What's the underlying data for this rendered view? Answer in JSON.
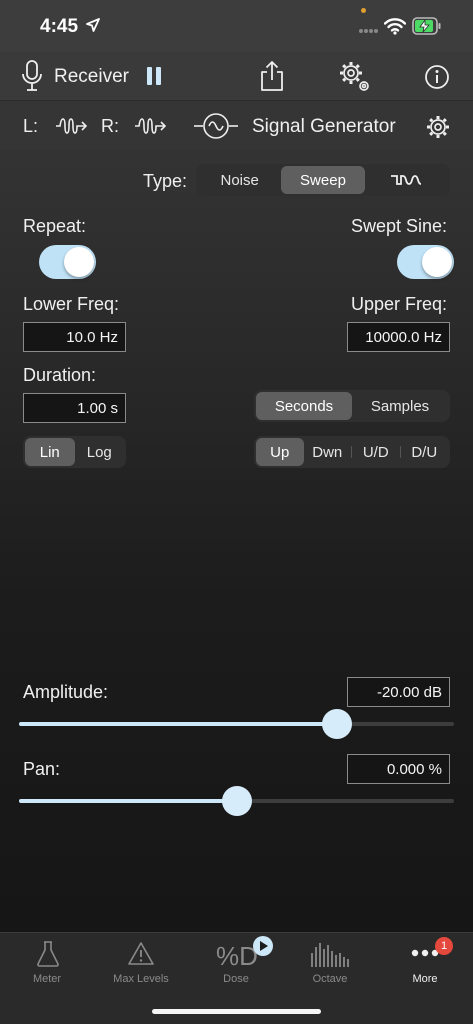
{
  "status_bar": {
    "time": "4:45"
  },
  "header": {
    "receiver_label": "Receiver",
    "left_channel_label": "L:",
    "right_channel_label": "R:",
    "generator_label": "Signal Generator"
  },
  "type_selector": {
    "label": "Type:",
    "options": [
      "Noise",
      "Sweep",
      "⊓∿"
    ],
    "selected": "Sweep"
  },
  "repeat": {
    "label": "Repeat:",
    "on": true
  },
  "swept_sine": {
    "label": "Swept Sine:",
    "on": true
  },
  "lower_freq": {
    "label": "Lower Freq:",
    "value": "10.0 Hz"
  },
  "upper_freq": {
    "label": "Upper Freq:",
    "value": "10000.0 Hz"
  },
  "duration": {
    "label": "Duration:",
    "value": "1.00 s"
  },
  "duration_unit": {
    "options": [
      "Seconds",
      "Samples"
    ],
    "selected": "Seconds"
  },
  "scale": {
    "options": [
      "Lin",
      "Log"
    ],
    "selected": "Lin"
  },
  "direction": {
    "options": [
      "Up",
      "Dwn",
      "U/D",
      "D/U"
    ],
    "selected": "Up"
  },
  "amplitude": {
    "label": "Amplitude:",
    "value": "-20.00 dB",
    "slider_fraction": 0.73
  },
  "pan": {
    "label": "Pan:",
    "value": "0.000 %",
    "slider_fraction": 0.5
  },
  "tabs": [
    {
      "label": "Meter",
      "icon": "flask-icon"
    },
    {
      "label": "Max Levels",
      "icon": "warning-triangle-icon"
    },
    {
      "label": "Dose",
      "icon": "dose-icon"
    },
    {
      "label": "Octave",
      "icon": "octave-bars-icon"
    },
    {
      "label": "More",
      "icon": "more-dots-icon",
      "badge": "1"
    }
  ],
  "colors": {
    "accent": "#cde8f8",
    "badge": "#e5483c",
    "battery": "#4cd964"
  }
}
